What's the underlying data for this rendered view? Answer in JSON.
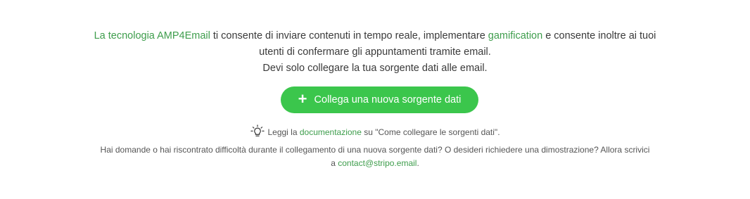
{
  "intro": {
    "link_tech": "La tecnologia AMP4Email",
    "text_1": " ti consente di inviare contenuti in tempo reale, implementare ",
    "link_gamification": "gamification",
    "text_2": " e consente inoltre ai tuoi",
    "line_2": "utenti di confermare gli appuntamenti tramite email.",
    "line_3": "Devi solo collegare la tua sorgente dati alle email."
  },
  "button": {
    "icon": "plus-icon",
    "label": "Collega una nuova sorgente dati"
  },
  "help": {
    "icon": "lightbulb-icon",
    "read_prefix": "Leggi la ",
    "doc_link": "documentazione",
    "read_suffix": " su \"Come collegare le sorgenti dati\".",
    "line_2": "Hai domande o hai riscontrato difficoltà durante il collegamento di una nuova sorgente dati? O desideri richiedere una dimostrazione? Allora scrivici",
    "line_3_prefix": "a ",
    "email_link": "contact@stripo.email",
    "line_3_suffix": "."
  },
  "colors": {
    "accent": "#3bc64c",
    "link": "#3e9d4c",
    "text": "#3a3a3a"
  }
}
